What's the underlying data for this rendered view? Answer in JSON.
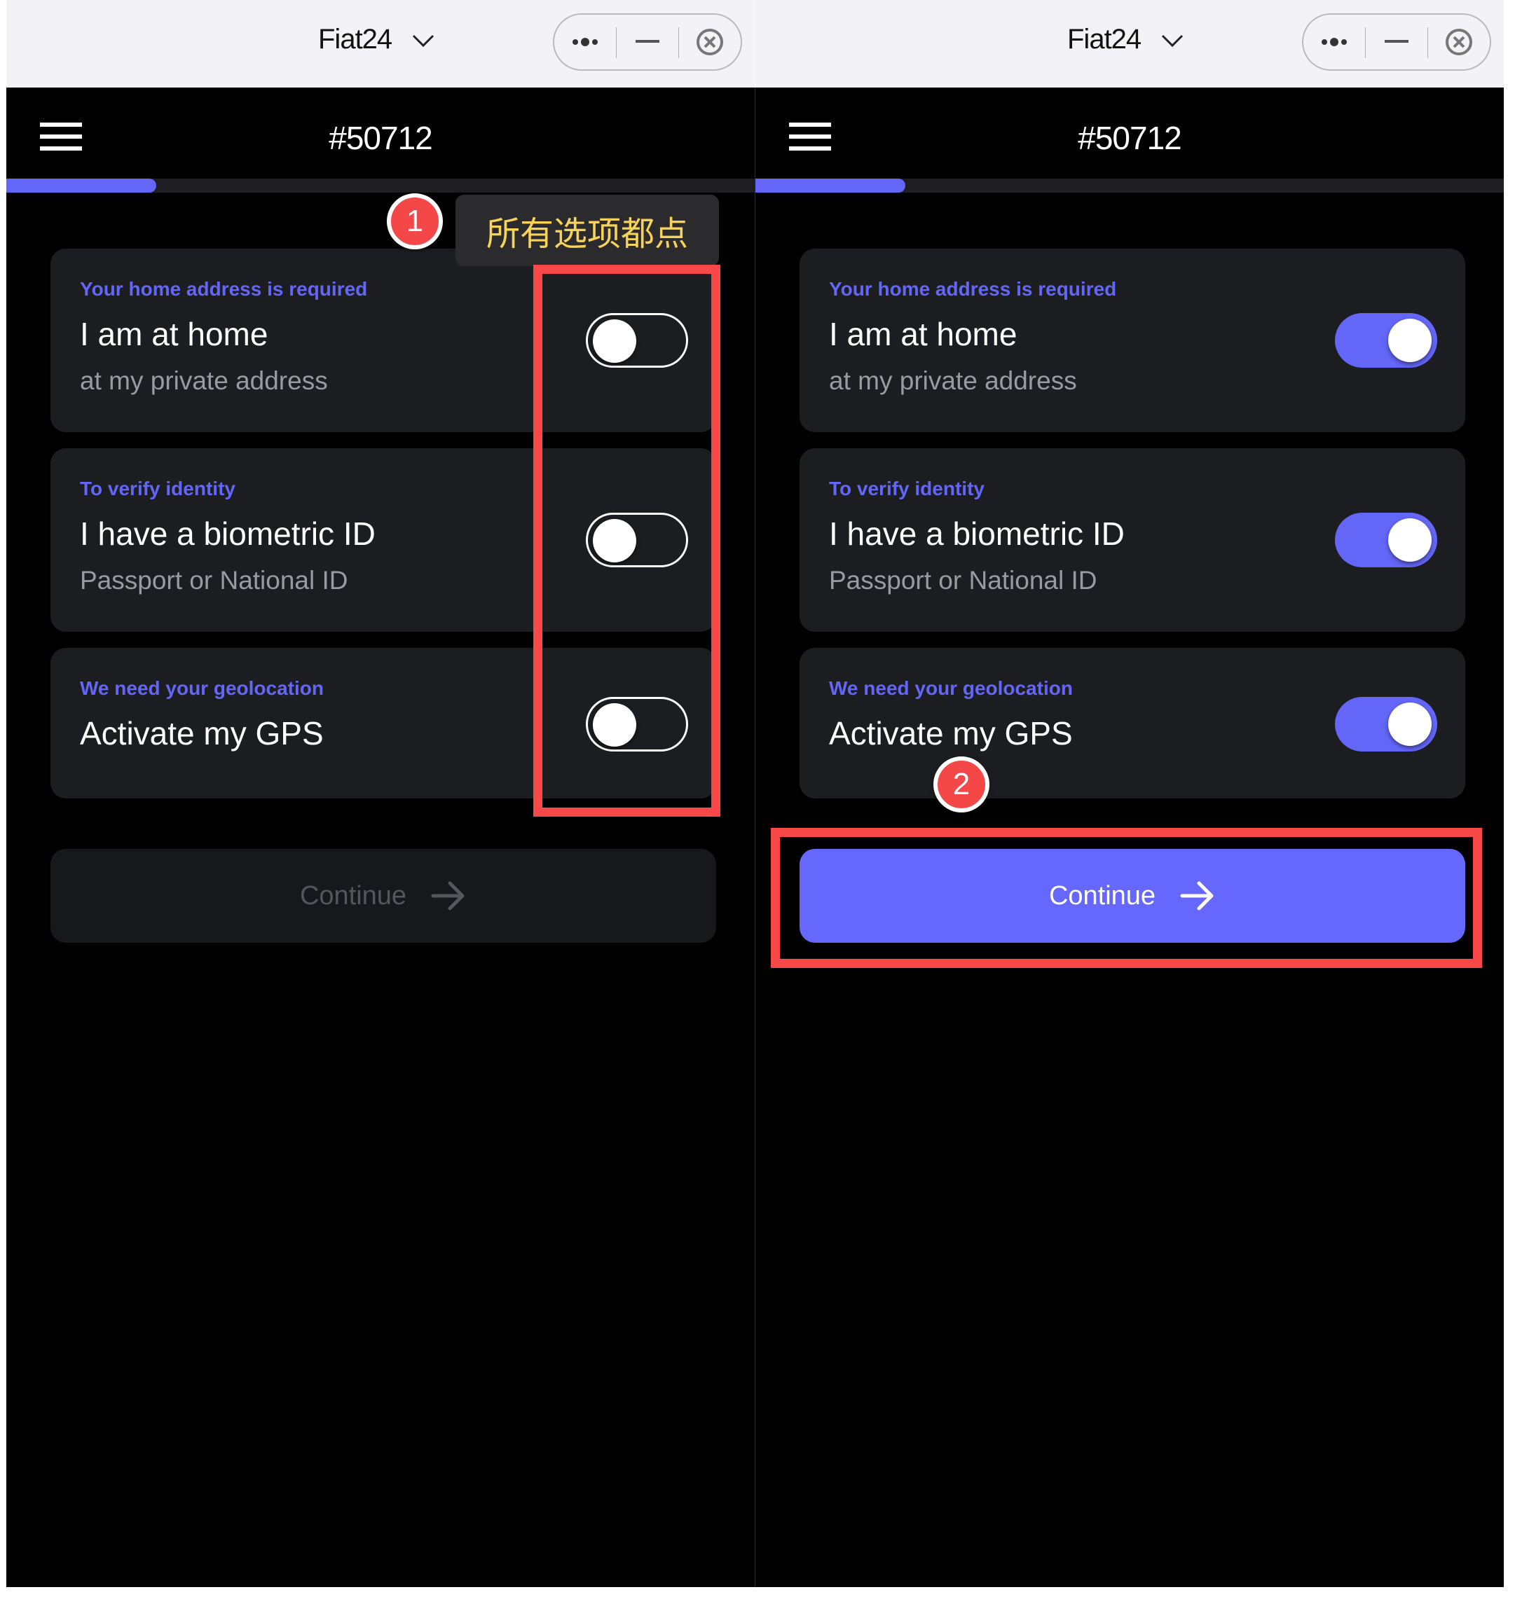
{
  "window": {
    "app_title": "Fiat24",
    "chevron_icon": "chevron-down-icon",
    "capsule_icons": [
      "more-dots-icon",
      "minimize-icon",
      "close-circle-icon"
    ]
  },
  "header": {
    "menu_icon": "hamburger-menu-icon",
    "title": "#50712",
    "progress_percent": 20
  },
  "panels": [
    {
      "state": "before",
      "options": [
        {
          "kicker": "Your home address is required",
          "title": "I am at home",
          "subtitle": "at my private address",
          "checked": false
        },
        {
          "kicker": "To verify identity",
          "title": "I have a biometric ID",
          "subtitle": "Passport or National ID",
          "checked": false
        },
        {
          "kicker": "We need your geolocation",
          "title": "Activate my GPS",
          "subtitle": "",
          "checked": false
        }
      ],
      "continue": {
        "label": "Continue",
        "enabled": false
      }
    },
    {
      "state": "after",
      "options": [
        {
          "kicker": "Your home address is required",
          "title": "I am at home",
          "subtitle": "at my private address",
          "checked": true
        },
        {
          "kicker": "To verify identity",
          "title": "I have a biometric ID",
          "subtitle": "Passport or National ID",
          "checked": true
        },
        {
          "kicker": "We need your geolocation",
          "title": "Activate my GPS",
          "subtitle": "",
          "checked": true
        }
      ],
      "continue": {
        "label": "Continue",
        "enabled": true
      }
    }
  ],
  "annotations": {
    "step1_badge": "1",
    "step1_tip": "所有选项都点",
    "step2_badge": "2"
  },
  "colors": {
    "accent": "#6366f6",
    "button_enabled": "#6668fd",
    "annotation_red": "#f84848",
    "tip_text": "#f7d35a",
    "card_bg": "#1c1d21"
  }
}
